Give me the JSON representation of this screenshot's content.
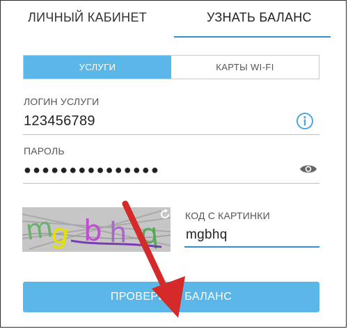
{
  "tabs": {
    "personal": "ЛИЧНЫЙ КАБИНЕТ",
    "balance": "УЗНАТЬ БАЛАНС"
  },
  "segment": {
    "services": "УСЛУГИ",
    "wifi_cards": "КАРТЫ WI-FI"
  },
  "login": {
    "label": "ЛОГИН УСЛУГИ",
    "value": "123456789"
  },
  "password": {
    "label": "ПАРОЛЬ",
    "value": "●●●●●●●●●●●●●●●"
  },
  "captcha": {
    "label": "КОД С КАРТИНКИ",
    "value": "mgbhq",
    "image_text": "mgbhq"
  },
  "submit": {
    "label": "ПРОВЕРИТЬ БАЛАНС"
  },
  "icons": {
    "info": "info-icon",
    "eye": "eye-icon",
    "refresh": "refresh-icon"
  },
  "colors": {
    "accent": "#5bb7e8",
    "indicator": "#2e8fd1",
    "arrow": "#d42a2a"
  }
}
